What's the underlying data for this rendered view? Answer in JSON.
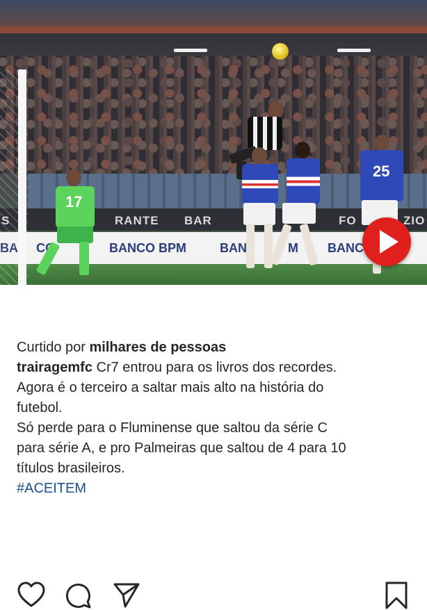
{
  "media": {
    "ad_boards_top": [
      "S",
      "RANTE",
      "BAR",
      "FO",
      "ZIO"
    ],
    "ad_boards_bottom": [
      "BA",
      "CO",
      "BANCO BPM",
      "BAN",
      "M",
      "BANC"
    ],
    "jersey_numbers": {
      "goalkeeper": "17",
      "player_right": "25"
    },
    "play_icon": "play-icon",
    "colors": {
      "play_button": "#e0201d",
      "hashtag": "#1d4f91"
    }
  },
  "actions": {
    "like_icon": "heart-icon",
    "comment_icon": "comment-icon",
    "share_icon": "send-icon",
    "save_icon": "bookmark-icon"
  },
  "post": {
    "likes_prefix": "Curtido por",
    "likes_count": "milhares de pessoas",
    "username": "trairagemfc",
    "caption_line1": "Cr7 entrou para os livros dos recordes.",
    "caption_line2": "Agora é o terceiro a saltar mais alto na história do",
    "caption_line3": "futebol.",
    "caption_line4": "Só perde para o Fluminense que saltou da série C",
    "caption_line5": "para série A, e pro Palmeiras que saltou de 4 para 10",
    "caption_line6": "títulos brasileiros.",
    "hashtag": "#ACEITEM"
  }
}
